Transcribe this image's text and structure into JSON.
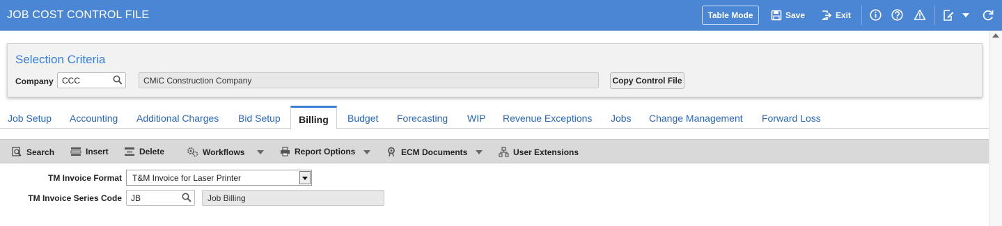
{
  "header": {
    "title": "JOB COST CONTROL FILE",
    "table_mode_label": "Table Mode",
    "save_label": "Save",
    "exit_label": "Exit"
  },
  "selection": {
    "title": "Selection Criteria",
    "company_label": "Company",
    "company_value": "CCC",
    "company_name": "CMiC Construction Company",
    "copy_button_label": "Copy Control File"
  },
  "tabs": [
    {
      "label": "Job Setup"
    },
    {
      "label": "Accounting"
    },
    {
      "label": "Additional Charges"
    },
    {
      "label": "Bid Setup"
    },
    {
      "label": "Billing",
      "active": true
    },
    {
      "label": "Budget"
    },
    {
      "label": "Forecasting"
    },
    {
      "label": "WIP"
    },
    {
      "label": "Revenue Exceptions"
    },
    {
      "label": "Jobs"
    },
    {
      "label": "Change Management"
    },
    {
      "label": "Forward Loss"
    }
  ],
  "toolbar": {
    "search_label": "Search",
    "insert_label": "Insert",
    "delete_label": "Delete",
    "workflows_label": "Workflows",
    "report_options_label": "Report Options",
    "ecm_documents_label": "ECM Documents",
    "user_extensions_label": "User Extensions"
  },
  "form": {
    "tm_invoice_format_label": "TM Invoice Format",
    "tm_invoice_format_value": "T&M Invoice for Laser Printer",
    "tm_invoice_series_code_label": "TM Invoice Series Code",
    "tm_invoice_series_code_value": "JB",
    "tm_invoice_series_desc": "Job Billing"
  },
  "colors": {
    "header_bg": "#4a86d4",
    "accent": "#3a7fd5",
    "tab_text": "#2a67b8",
    "toolbar_bg": "#d9d9d9"
  }
}
